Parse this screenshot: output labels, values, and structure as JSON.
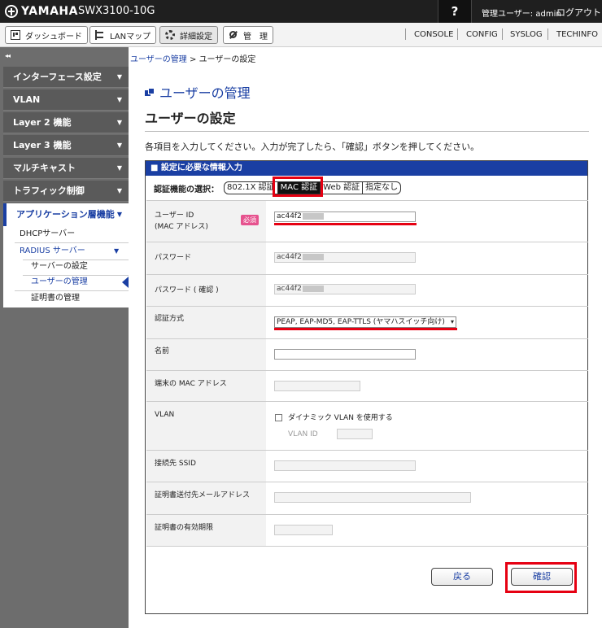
{
  "header": {
    "brand": "YAMAHA",
    "model": "SWX3100-10G",
    "help": "?",
    "admin_label": "管理ユーザー: admin",
    "logout": "ログアウト"
  },
  "toolbar": {
    "dashboard": "ダッシュボード",
    "lanmap": "LANマップ",
    "detail": "詳細設定",
    "manage": "管　理",
    "links": [
      "CONSOLE",
      "CONFIG",
      "SYSLOG",
      "TECHINFO"
    ]
  },
  "sidebar": {
    "collapse": "◂◂",
    "items": [
      "インターフェース設定",
      "VLAN",
      "Layer 2 機能",
      "Layer 3 機能",
      "マルチキャスト",
      "トラフィック制御"
    ],
    "active": "アプリケーション層機能",
    "sub": {
      "dhcp": "DHCPサーバー",
      "radius": "RADIUS サーバー",
      "server_settings": "サーバーの設定",
      "user_mgmt": "ユーザーの管理",
      "cert_mgmt": "証明書の管理"
    }
  },
  "breadcrumb": {
    "parent": "ユーザーの管理",
    "sep": " > ",
    "current": "ユーザーの設定"
  },
  "section_title": "ユーザーの管理",
  "page_title": "ユーザーの設定",
  "instruction": "各項目を入力してください。入力が完了したら、「確認」ボタンを押してください。",
  "panel": {
    "heading": "■ 設定に必要な情報入力",
    "method_label": "認証機能の選択：",
    "methods": [
      "802.1X 認証",
      "MAC 認証",
      "Web 認証",
      "指定なし"
    ],
    "required_badge": "必須",
    "fields": {
      "user_id_label": "ユーザー ID",
      "user_id_sub": "(MAC アドレス)",
      "user_id_value": "ac44f2",
      "password_label": "パスワード",
      "password_value": "ac44f2",
      "password_confirm_label": "パスワード ( 確認 )",
      "password_confirm_value": "ac44f2",
      "auth_method_label": "認証方式",
      "auth_method_value": "PEAP, EAP-MD5, EAP-TTLS (ヤマハスイッチ向け)",
      "name_label": "名前",
      "mac_label": "端末の MAC アドレス",
      "vlan_label": "VLAN",
      "vlan_dynamic": "ダイナミック VLAN を使用する",
      "vlan_id_label": "VLAN ID",
      "ssid_label": "接続先 SSID",
      "email_label": "証明書送付先メールアドレス",
      "expiry_label": "証明書の有効期限"
    },
    "back": "戻る",
    "confirm": "確認"
  }
}
